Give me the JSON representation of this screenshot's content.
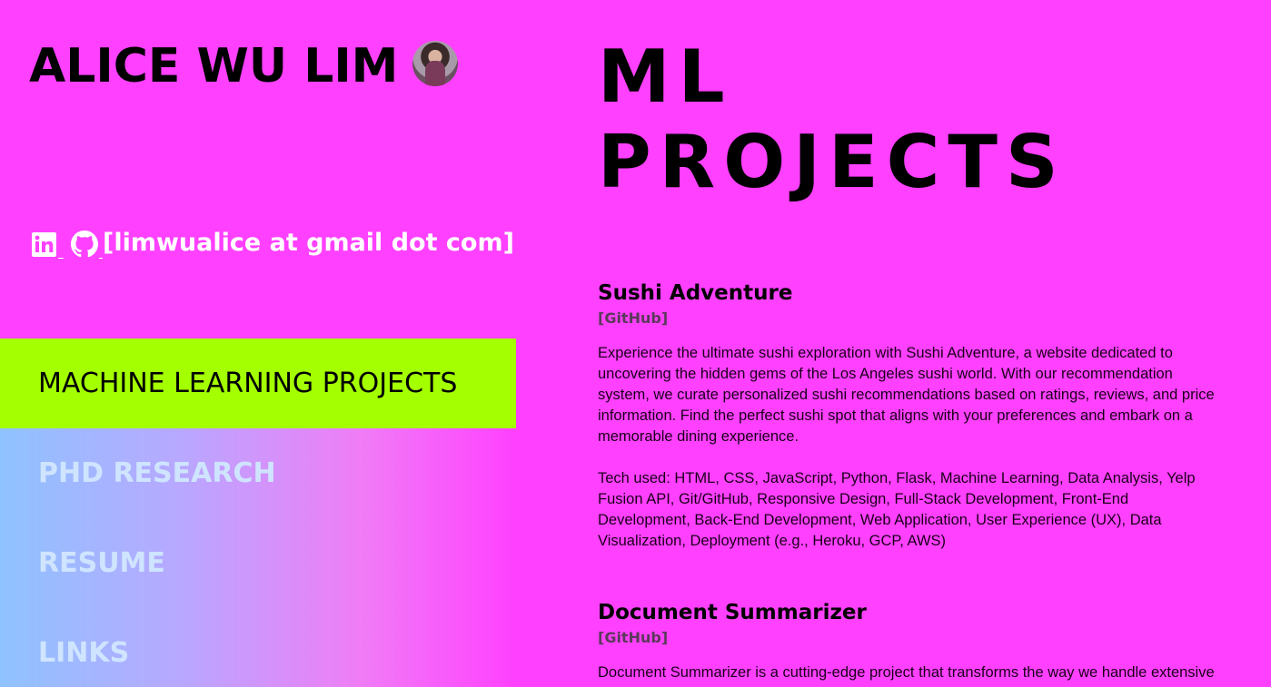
{
  "profile": {
    "name": "ALICE WU LIM",
    "email": "[limwualice at gmail dot com]"
  },
  "icons": {
    "linkedin": "linkedin-icon",
    "github": "github-icon"
  },
  "nav": {
    "items": [
      {
        "label": "MACHINE LEARNING PROJECTS",
        "active": true
      },
      {
        "label": "PHD RESEARCH",
        "active": false
      },
      {
        "label": "RESUME",
        "active": false
      },
      {
        "label": "LINKS",
        "active": false
      }
    ]
  },
  "main": {
    "title_line1": "ML",
    "title_line2": "PROJECTS",
    "projects": [
      {
        "title": "Sushi Adventure",
        "link": "[GitHub]",
        "description": "Experience the ultimate sushi exploration with Sushi Adventure, a website dedicated to uncovering the hidden gems of the Los Angeles sushi world. With our recommendation system, we curate personalized sushi recommendations based on ratings, reviews, and price information. Find the perfect sushi spot that aligns with your preferences and embark on a memorable dining experience.",
        "tech": "Tech used: HTML, CSS, JavaScript, Python, Flask, Machine Learning, Data Analysis, Yelp Fusion API, Git/GitHub, Responsive Design, Full-Stack Development, Front-End Development, Back-End Development, Web Application, User Experience (UX), Data Visualization, Deployment (e.g., Heroku, GCP, AWS)"
      },
      {
        "title": "Document Summarizer",
        "link": "[GitHub]",
        "description": "Document Summarizer is a cutting-edge project that transforms the way we handle extensive"
      }
    ]
  },
  "colors": {
    "background": "#ff40ff",
    "active_nav": "#a4ff00",
    "nav_text": "#cfe4ff",
    "gradient_start": "#8fc3ff"
  }
}
